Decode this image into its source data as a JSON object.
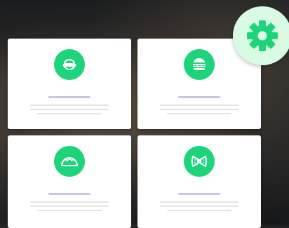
{
  "colors": {
    "accent": "#1ed47a",
    "gear_background": "#d9fbe3",
    "title_placeholder": "#c8c6e0",
    "text_placeholder": "#e3e3e8"
  },
  "settings": {
    "icon": "gear-icon"
  },
  "cards": [
    {
      "icon": "rice-bowl-icon"
    },
    {
      "icon": "burger-icon"
    },
    {
      "icon": "taco-icon"
    },
    {
      "icon": "pasta-bow-icon"
    }
  ]
}
